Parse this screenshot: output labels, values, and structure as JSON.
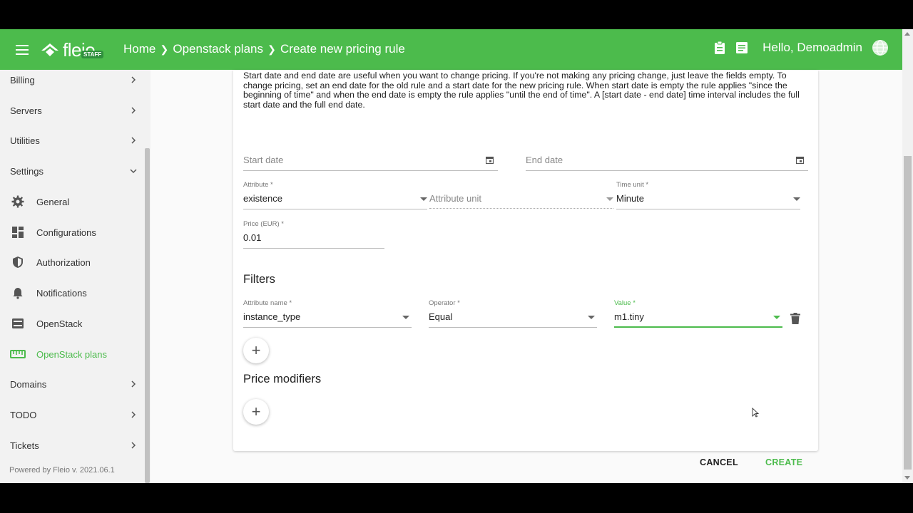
{
  "header": {
    "logo_text": "fleio",
    "logo_badge": "STAFF",
    "breadcrumbs": [
      "Home",
      "Openstack plans",
      "Create new pricing rule"
    ],
    "greeting": "Hello, Demoadmin",
    "icons": [
      "menu-icon",
      "clipboard-icon",
      "notes-icon",
      "globe-icon"
    ],
    "bg_color": "#4cbb4c"
  },
  "sidebar": {
    "items": [
      {
        "label": "Billing",
        "type": "group"
      },
      {
        "label": "Servers",
        "type": "group"
      },
      {
        "label": "Utilities",
        "type": "group"
      },
      {
        "label": "Settings",
        "type": "group-open"
      },
      {
        "label": "General",
        "type": "sub",
        "icon": "gear-icon"
      },
      {
        "label": "Configurations",
        "type": "sub",
        "icon": "dashboard-icon"
      },
      {
        "label": "Authorization",
        "type": "sub",
        "icon": "shield-icon"
      },
      {
        "label": "Notifications",
        "type": "sub",
        "icon": "bell-icon"
      },
      {
        "label": "OpenStack",
        "type": "sub",
        "icon": "server-icon"
      },
      {
        "label": "OpenStack plans",
        "type": "sub-active",
        "icon": "ruler-icon"
      },
      {
        "label": "Domains",
        "type": "group"
      },
      {
        "label": "TODO",
        "type": "group"
      },
      {
        "label": "Tickets",
        "type": "group"
      }
    ],
    "powered_by": "Powered by Fleio v. 2021.06.1"
  },
  "form": {
    "info_text": "Start date and end date are useful when you want to change pricing. If you're not making any pricing change, just leave the fields empty. To change pricing, set an end date for the old rule and a start date for the new pricing rule. When start date is empty the rule applies \"since the beginning of time\" and when the end date is empty the rule applies \"until the end of time\". A [start date - end date] time interval includes the full start date and the full end date.",
    "start_date_placeholder": "Start date",
    "end_date_placeholder": "End date",
    "attribute_label": "Attribute *",
    "attribute_value": "existence",
    "attribute_unit_placeholder": "Attribute unit",
    "time_unit_label": "Time unit *",
    "time_unit_value": "Minute",
    "price_label": "Price (EUR) *",
    "price_value": "0.01",
    "filters_title": "Filters",
    "filter": {
      "attr_name_label": "Attribute name *",
      "attr_name_value": "instance_type",
      "operator_label": "Operator *",
      "operator_value": "Equal",
      "value_label": "Value *",
      "value_value": "m1.tiny"
    },
    "price_modifiers_title": "Price modifiers",
    "add_symbol": "+",
    "cancel_label": "CANCEL",
    "create_label": "CREATE",
    "accent_color": "#4cbb4c"
  }
}
